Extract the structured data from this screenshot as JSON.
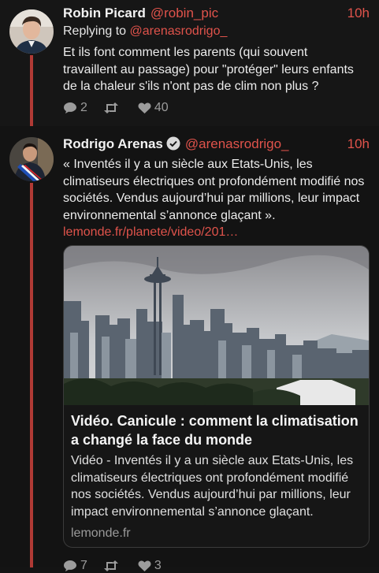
{
  "tweets": [
    {
      "name": "Robin Picard",
      "handle": "@robin_pic",
      "time": "10h",
      "replying_prefix": "Replying to ",
      "replying_handle": "@arenasrodrigo_",
      "text": "Et ils font comment les parents (qui souvent travaillent au passage) pour \"protéger\" leurs enfants de la chaleur s'ils n'ont pas de clim non plus ?",
      "replies": "2",
      "retweets": "",
      "likes": "40"
    },
    {
      "name": "Rodrigo Arenas",
      "handle": "@arenasrodrigo_",
      "time": "10h",
      "text": "« Inventés il y a un siècle aux Etats-Unis, les climatiseurs électriques ont profondément modifié nos sociétés. Vendus aujourd’hui par millions, leur impact environnemental s’annonce glaçant ».",
      "link": "lemonde.fr/planete/video/201…",
      "card": {
        "title": "Vidéo. Canicule : comment la climatisation a changé la face du monde",
        "description": "Vidéo - Inventés il y a un siècle aux Etats-Unis, les climatiseurs électriques ont profondément modifié nos sociétés. Vendus aujourd’hui par millions, leur impact environnemental s’annonce glaçant.",
        "domain": "lemonde.fr"
      },
      "replies": "7",
      "retweets": "",
      "likes": "3"
    }
  ],
  "colors": {
    "accent": "#e0534b",
    "thread_line": "#b03a35",
    "background": "#141414"
  },
  "icons": [
    "reply-icon",
    "retweet-icon",
    "heart-icon",
    "verified-icon"
  ]
}
